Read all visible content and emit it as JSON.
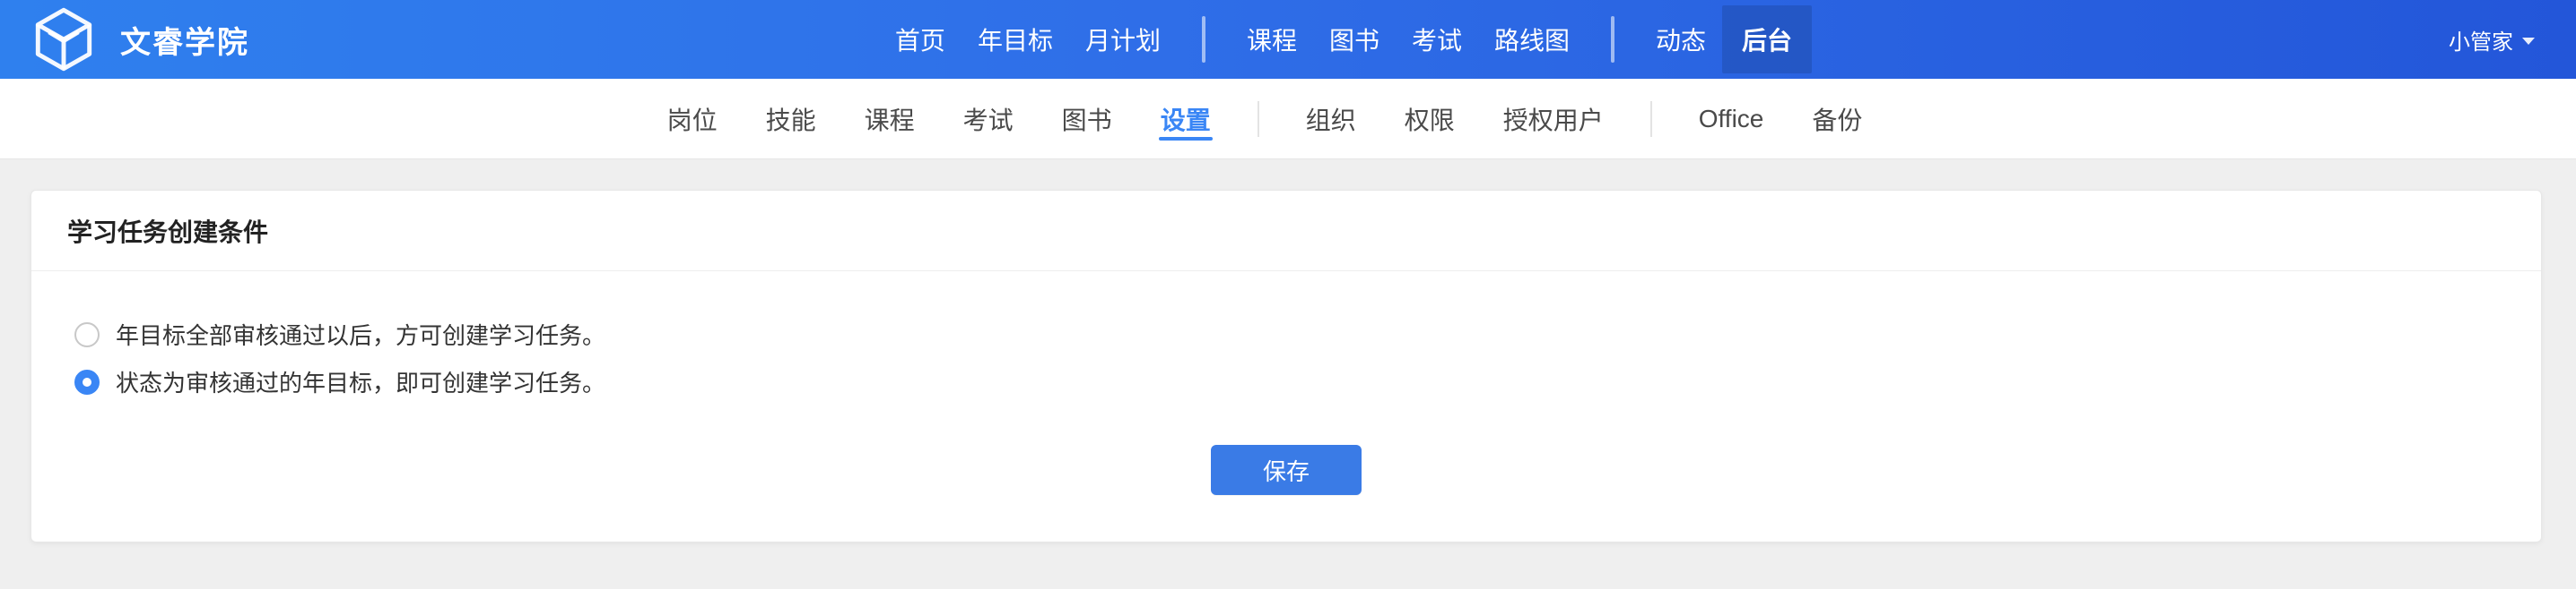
{
  "app": {
    "brand_name": "文睿学院",
    "user_name": "小管家",
    "colors": {
      "topbar_gradient_start": "#2f80ee",
      "topbar_gradient_end": "#2356d9",
      "accent": "#3a86f5",
      "background": "#efefef"
    }
  },
  "topbar": {
    "nav_group_1": [
      "首页",
      "年目标",
      "月计划"
    ],
    "nav_group_2": [
      "课程",
      "图书",
      "考试",
      "路线图"
    ],
    "nav_group_3": [
      "动态",
      "后台"
    ],
    "active": "后台"
  },
  "subbar": {
    "group_1": [
      "岗位",
      "技能",
      "课程",
      "考试",
      "图书",
      "设置"
    ],
    "group_2": [
      "组织",
      "权限",
      "授权用户"
    ],
    "group_3": [
      "Office",
      "备份"
    ],
    "active": "设置"
  },
  "card": {
    "title": "学习任务创建条件",
    "options": [
      {
        "label": "年目标全部审核通过以后，方可创建学习任务。",
        "checked": false
      },
      {
        "label": "状态为审核通过的年目标，即可创建学习任务。",
        "checked": true
      }
    ],
    "save_label": "保存"
  }
}
